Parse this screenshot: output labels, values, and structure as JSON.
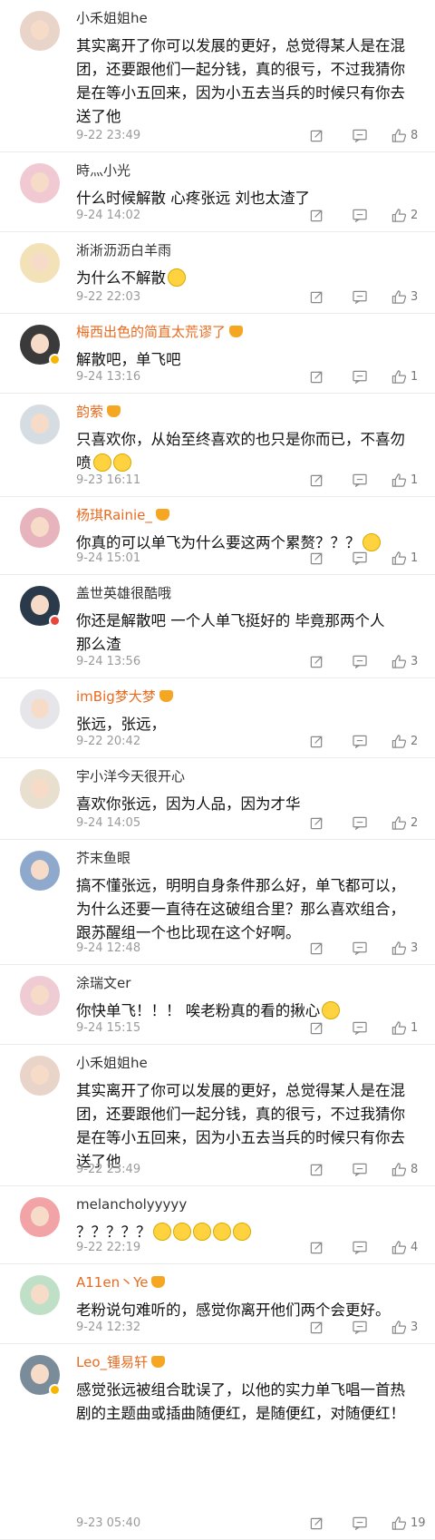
{
  "colors": {
    "vip_name": "#e86b1f",
    "name": "#333333",
    "text": "#111111",
    "meta": "#9a9a9a",
    "divider": "#ececec",
    "vip_badge": "#f7b500"
  },
  "icons": [
    "share-icon",
    "comment-icon",
    "thumbs-up-icon",
    "crown-icon",
    "verified-badge-icon",
    "emoji-icon"
  ],
  "comments": [
    {
      "name": "小禾姐姐he",
      "vip": false,
      "lines": [
        "其实离开了你可以发展的更好，总觉得某人是在混",
        "团，还要跟他们一起分钱，真的很亏，不过我猜你",
        "是在等小五回来，因为小五去当兵的时候只有你去",
        "送了他"
      ],
      "time": "9-22 23:49",
      "likes": "8"
    },
    {
      "name": "時灬小光",
      "vip": false,
      "lines": [
        "什么时候解散 心疼张远 刘也太渣了"
      ],
      "time": "9-24 14:02",
      "likes": "2"
    },
    {
      "name": "淅淅沥沥白羊雨",
      "vip": false,
      "lines": [
        "为什么不解散"
      ],
      "time": "9-22 22:03",
      "likes": "3"
    },
    {
      "name": "梅西出色的简直太荒谬了",
      "vip": true,
      "lines": [
        "解散吧，单飞吧"
      ],
      "time": "9-24 13:16",
      "likes": "1"
    },
    {
      "name": "韵萦",
      "vip": true,
      "lines": [
        "只喜欢你，从始至终喜欢的也只是你而已，不喜勿",
        "喷"
      ],
      "time": "9-23 16:11",
      "likes": "1"
    },
    {
      "name": "杨琪Rainie_",
      "vip": true,
      "lines": [
        "你真的可以单飞为什么要这两个累赘？？？"
      ],
      "time": "9-24 15:01",
      "likes": "1"
    },
    {
      "name": "盖世英雄很酷哦",
      "vip": false,
      "lines": [
        "你还是解散吧  一个人单飞挺好的  毕竟那两个人",
        "那么渣"
      ],
      "time": "9-24 13:56",
      "likes": "3"
    },
    {
      "name": "imBig梦大梦",
      "vip": true,
      "lines": [
        "张远，张远，"
      ],
      "time": "9-22 20:42",
      "likes": "2"
    },
    {
      "name": "宇小洋今天很开心",
      "vip": false,
      "lines": [
        "喜欢你张远，因为人品，因为才华"
      ],
      "time": "9-24 14:05",
      "likes": "2"
    },
    {
      "name": "芥末鱼眼",
      "vip": false,
      "lines": [
        "搞不懂张远，明明自身条件那么好，单飞都可以，",
        "为什么还要一直待在这破组合里？那么喜欢组合，",
        "跟苏醒组一个也比现在这个好啊。"
      ],
      "time": "9-24 12:48",
      "likes": "3"
    },
    {
      "name": "涂瑞文er",
      "vip": false,
      "lines": [
        "你快单飞！！！ 唉老粉真的看的揪心"
      ],
      "time": "9-24 15:15",
      "likes": "1"
    },
    {
      "name": "小禾姐姐he",
      "vip": false,
      "lines": [
        "其实离开了你可以发展的更好，总觉得某人是在混",
        "团，还要跟他们一起分钱，真的很亏，不过我猜你",
        "是在等小五回来，因为小五去当兵的时候只有你去",
        "送了他"
      ],
      "time": "9-22 23:49",
      "likes": "8"
    },
    {
      "name": "melancholyyyyy",
      "vip": false,
      "lines": [
        "？？？？？"
      ],
      "time": "9-22 22:19",
      "likes": "4"
    },
    {
      "name": "A11en丶Ye",
      "vip": true,
      "lines": [
        "老粉说句难听的，感觉你离开他们两个会更好。"
      ],
      "time": "9-24 12:32",
      "likes": "3"
    },
    {
      "name": "Leo_锺易轩",
      "vip": true,
      "lines": [
        "感觉张远被组合耽误了，以他的实力单飞唱一首热",
        "剧的主题曲或插曲随便红，是随便红，对随便红！"
      ],
      "time": "9-23 05:40",
      "likes": "19"
    }
  ]
}
